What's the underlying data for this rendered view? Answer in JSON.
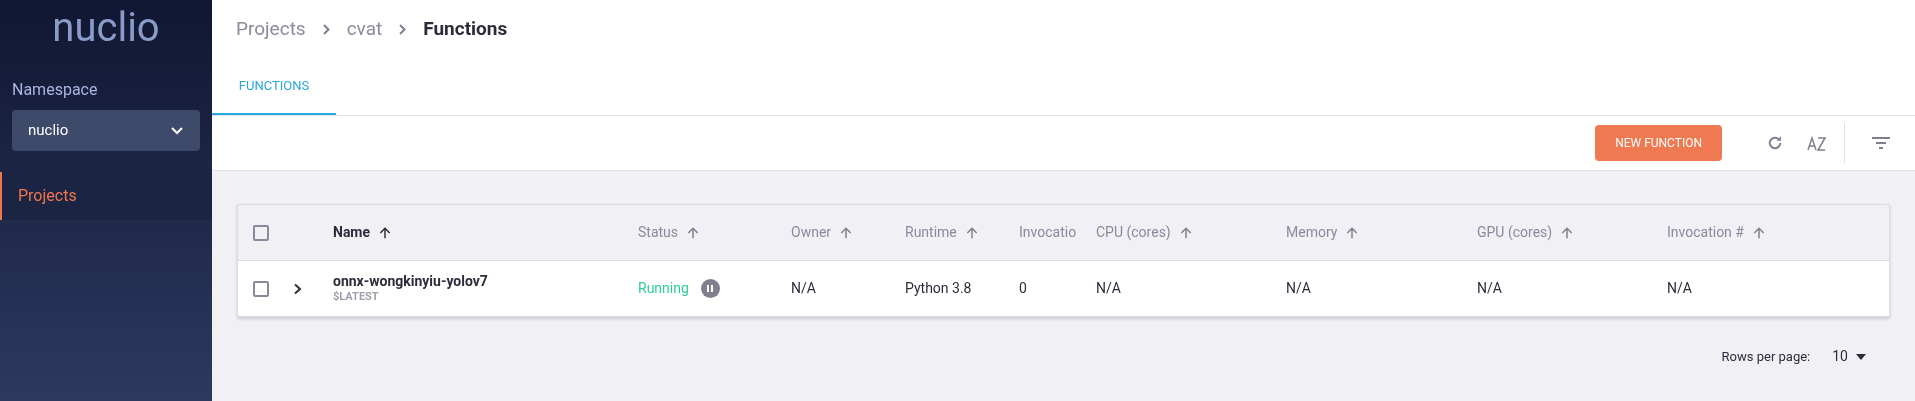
{
  "sidebar": {
    "logo": "nuclio",
    "namespace_label": "Namespace",
    "namespace_select": {
      "value": "nuclio"
    },
    "items": [
      {
        "label": "Projects",
        "selected": true
      }
    ]
  },
  "breadcrumbs": [
    "Projects",
    "cvat",
    "Functions"
  ],
  "tabs": [
    {
      "label": "FUNCTIONS",
      "selected": true
    }
  ],
  "toolbar": {
    "new_button": "NEW FUNCTION"
  },
  "table": {
    "select_all_checked": false,
    "columns": [
      {
        "label": "Name",
        "active": true
      },
      {
        "label": "Status",
        "active": false
      },
      {
        "label": "Owner",
        "active": false
      },
      {
        "label": "Runtime",
        "active": false
      },
      {
        "label": "Invocatio",
        "active": false,
        "sortable": false
      },
      {
        "label": "CPU (cores)",
        "active": false
      },
      {
        "label": "Memory",
        "active": false
      },
      {
        "label": "GPU (cores)",
        "active": false
      },
      {
        "label": "Invocation #",
        "active": false
      }
    ],
    "rows": [
      {
        "checked": false,
        "expanded": false,
        "name": "onnx-wongkinyiu-yolov7",
        "version": "$LATEST",
        "status": "Running",
        "owner": "N/A",
        "runtime": "Python 3.8",
        "invocation": "0",
        "cpu": "N/A",
        "memory": "N/A",
        "gpu": "N/A",
        "invocation_count": "N/A"
      }
    ]
  },
  "pagination": {
    "label": "Rows per page:",
    "value": "10"
  }
}
